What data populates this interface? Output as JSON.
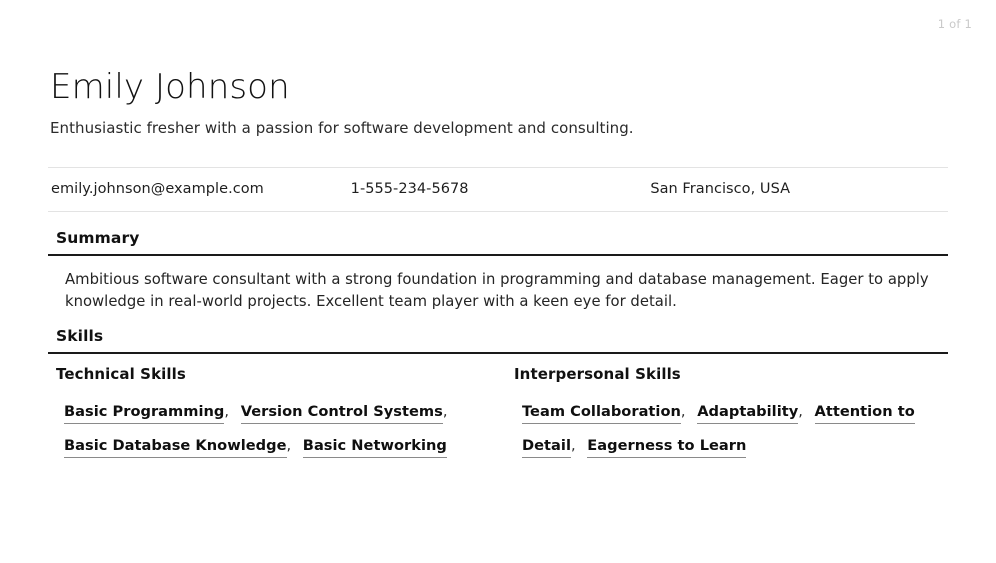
{
  "document": {
    "page_indicator": "1 of 1"
  },
  "header": {
    "name": "Emily Johnson",
    "tagline": "Enthusiastic fresher with a passion for software development and consulting."
  },
  "contact": {
    "email": "emily.johnson@example.com",
    "phone": "1-555-234-5678",
    "location": "San Francisco, USA"
  },
  "sections": {
    "summary": {
      "title": "Summary",
      "text": "Ambitious software consultant with a strong foundation in programming and database management. Eager to apply knowledge in real-world projects. Excellent team player with a keen eye for detail."
    },
    "skills": {
      "title": "Skills",
      "technical": {
        "subtitle": "Technical Skills",
        "items": [
          "Basic Programming",
          "Version Control Systems",
          "Basic Database Knowledge",
          "Basic Networking"
        ]
      },
      "interpersonal": {
        "subtitle": "Interpersonal Skills",
        "items": [
          "Team Collaboration",
          "Adaptability",
          "Attention to Detail",
          "Eagerness to Learn"
        ]
      }
    }
  },
  "separator": ",",
  "colors": {
    "text": "#1a1a1a",
    "rule_dark": "#1a1a1a",
    "rule_light": "#e3e3e3",
    "skill_underline": "#8a8a8a",
    "page_indicator": "#c9c9c9"
  }
}
